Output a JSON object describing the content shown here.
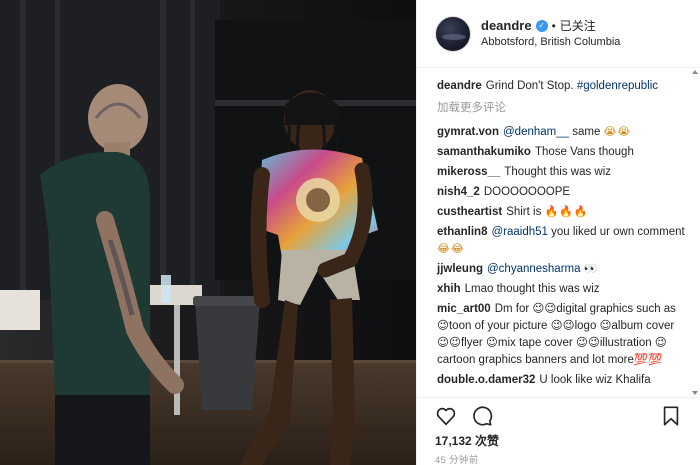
{
  "post": {
    "username": "deandre",
    "follow_label": "已关注",
    "dot": "•",
    "location": "Abbotsford, British Columbia",
    "likes": "17,132 次赞",
    "time": "45 分钟前"
  },
  "caption": {
    "user": "deandre",
    "text": "Grind Don't Stop.",
    "tag": "#goldenrepublic"
  },
  "load_more": "加载更多评论",
  "comments": [
    {
      "user": "gymrat.von",
      "mention": "@denham__",
      "text": " same ",
      "emoji": "😭😭"
    },
    {
      "user": "samanthakumiko",
      "text": "Those Vans though"
    },
    {
      "user": "mikeross__",
      "text": "Thought this was wiz"
    },
    {
      "user": "nish4_2",
      "text": "DOOOOOOOPE"
    },
    {
      "user": "custheartist",
      "text": "Shirt is ",
      "emoji": "🔥🔥🔥"
    },
    {
      "user": "ethanlin8",
      "mention": "@raaidh51",
      "text": " you liked ur own comment ",
      "emoji": "😂😂"
    },
    {
      "user": "jjwleung",
      "mention": "@chyannesharma",
      "text": " ",
      "emoji": "👀"
    },
    {
      "user": "xhih",
      "text": "Lmao thought this was wiz"
    },
    {
      "user": "mic_art00",
      "text": "Dm for 😉😉digital graphics such as 😉toon of your picture 😉😉logo 😉album cover 😉😉flyer 😉mix tape cover 😉😉illustration 😉cartoon graphics banners and lot more💯💯"
    },
    {
      "user": "double.o.damer32",
      "text": "U look like wiz Khalifa"
    }
  ],
  "icons": [
    "heart-icon",
    "comment-icon",
    "bookmark-icon",
    "verified-badge-icon"
  ]
}
